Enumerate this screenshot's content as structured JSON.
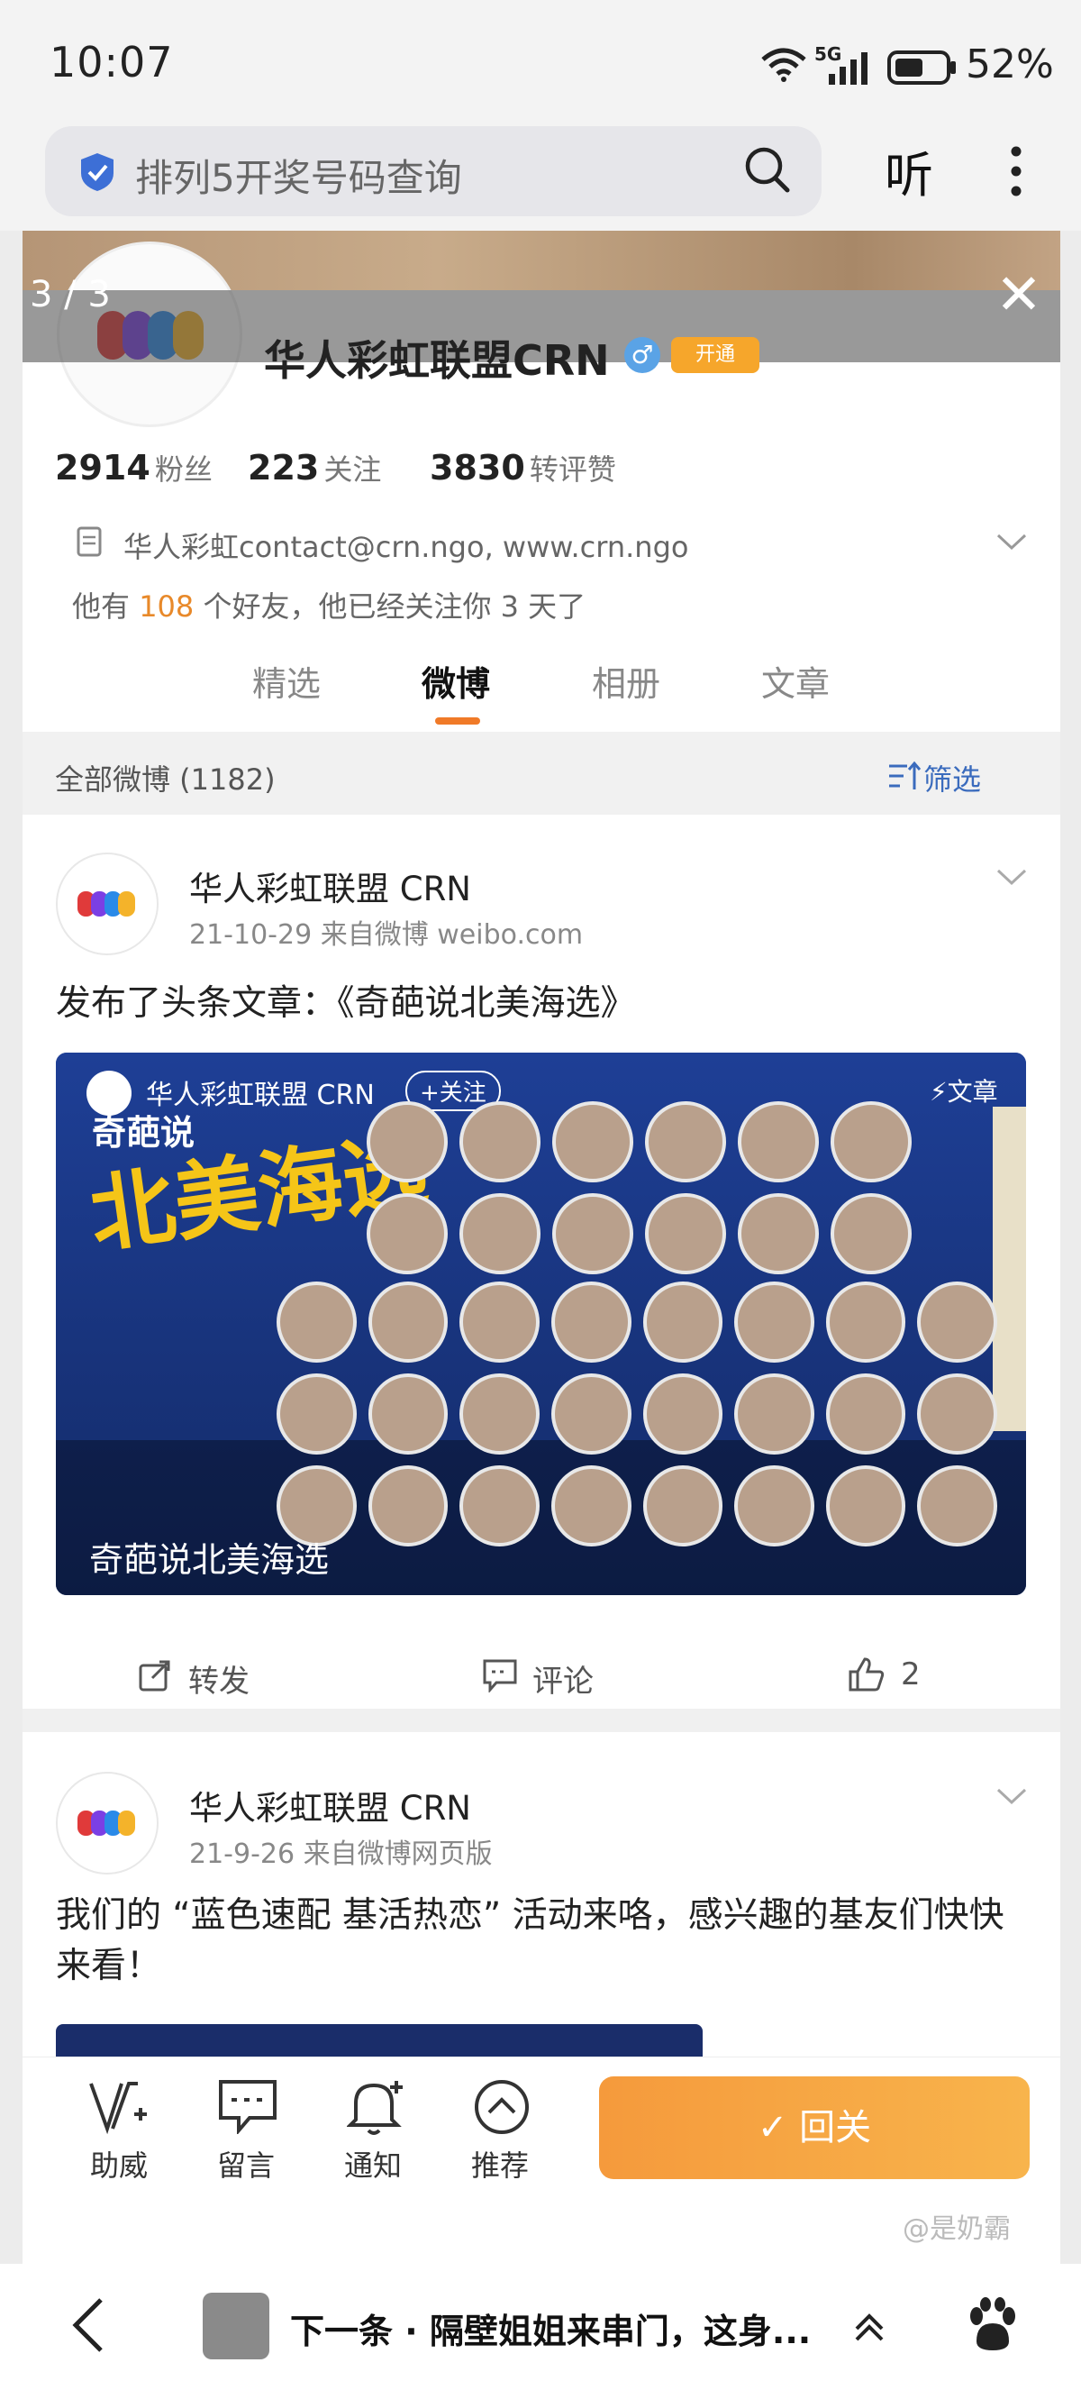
{
  "status": {
    "time": "10:07",
    "network": "5G",
    "battery": "52%"
  },
  "search": {
    "query": "排列5开奖号码查询",
    "listen_label": "听"
  },
  "viewer": {
    "counter": "3 / 3"
  },
  "profile": {
    "name": "华人彩虹联盟CRN",
    "vip_label": "开通",
    "stats": [
      {
        "num": "2914",
        "label": "粉丝"
      },
      {
        "num": "223",
        "label": "关注"
      },
      {
        "num": "3830",
        "label": "转评赞"
      }
    ],
    "description": "华人彩虹contact@crn.ngo, www.crn.ngo",
    "friends_prefix": "他有",
    "friends_count": "108",
    "friends_suffix": "个好友，他已经关注你 3 天了"
  },
  "tabs": [
    "精选",
    "微博",
    "相册",
    "文章"
  ],
  "feed_header": {
    "all": "全部微博 (1182)",
    "filter": "筛选"
  },
  "posts": [
    {
      "author": "华人彩虹联盟 CRN",
      "meta": "21-10-29  来自微博 weibo.com",
      "text": "发布了头条文章：《奇葩说北美海选》",
      "card": {
        "author": "华人彩虹联盟 CRN",
        "follow": "+关注",
        "type": "文章",
        "title": "奇葩说北美海选",
        "logo_text": "北美海选",
        "logo_sub": "奇葩说"
      },
      "actions": {
        "repost": "转发",
        "comment": "评论",
        "like": "2"
      }
    },
    {
      "author": "华人彩虹联盟 CRN",
      "meta": "21-9-26  来自微博网页版",
      "text": "我们的 “蓝色速配 基活热恋” 活动来咯，感兴趣的基友们快快来看！"
    }
  ],
  "toolbar": {
    "items": [
      "助威",
      "留言",
      "通知",
      "推荐"
    ],
    "follow_back": "回关"
  },
  "watermark": "@是奶霸",
  "bottom_nav": {
    "next": "下一条 · 隔壁姐姐来串门，这身..."
  }
}
